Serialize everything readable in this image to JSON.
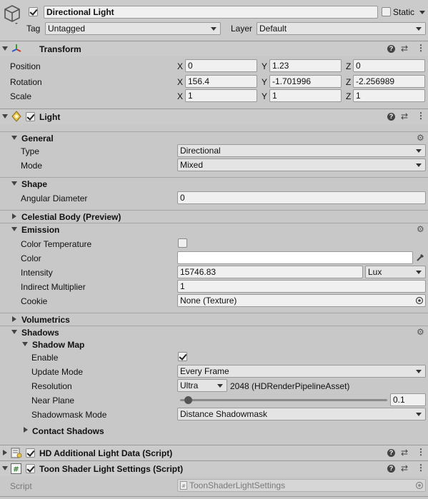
{
  "object": {
    "active": true,
    "name": "Directional Light",
    "static_label": "Static",
    "static_checked": false,
    "tag_label": "Tag",
    "tag_value": "Untagged",
    "layer_label": "Layer",
    "layer_value": "Default"
  },
  "transform": {
    "title": "Transform",
    "position_label": "Position",
    "rotation_label": "Rotation",
    "scale_label": "Scale",
    "axis_x": "X",
    "axis_y": "Y",
    "axis_z": "Z",
    "position": {
      "x": "0",
      "y": "1.23",
      "z": "0"
    },
    "rotation": {
      "x": "156.4",
      "y": "-1.701996",
      "z": "-2.256989"
    },
    "scale": {
      "x": "1",
      "y": "1",
      "z": "1"
    }
  },
  "light": {
    "title": "Light",
    "enabled": true,
    "general": {
      "title": "General",
      "type_label": "Type",
      "type_value": "Directional",
      "mode_label": "Mode",
      "mode_value": "Mixed"
    },
    "shape": {
      "title": "Shape",
      "angular_label": "Angular Diameter",
      "angular_value": "0"
    },
    "celestial": {
      "title": "Celestial Body (Preview)"
    },
    "emission": {
      "title": "Emission",
      "color_temp_label": "Color Temperature",
      "color_label": "Color",
      "color_value": "#ffffff",
      "intensity_label": "Intensity",
      "intensity_value": "15746.83",
      "intensity_unit": "Lux",
      "indirect_label": "Indirect Multiplier",
      "indirect_value": "1",
      "cookie_label": "Cookie",
      "cookie_value": "None (Texture)"
    },
    "volumetrics": {
      "title": "Volumetrics"
    },
    "shadows": {
      "title": "Shadows",
      "shadow_map_title": "Shadow Map",
      "enable_label": "Enable",
      "enable_checked": true,
      "update_label": "Update Mode",
      "update_value": "Every Frame",
      "resolution_label": "Resolution",
      "resolution_value": "Ultra",
      "resolution_detail": "2048 (HDRenderPipelineAsset)",
      "near_plane_label": "Near Plane",
      "near_plane_value": "0.1",
      "near_plane_fraction": 0.02,
      "shadowmask_label": "Shadowmask Mode",
      "shadowmask_value": "Distance Shadowmask",
      "contact_title": "Contact Shadows"
    }
  },
  "hd_additional": {
    "title": "HD Additional Light Data (Script)",
    "enabled": true
  },
  "toon": {
    "title": "Toon Shader Light Settings (Script)",
    "enabled": true,
    "script_label": "Script",
    "script_value": "ToonShaderLightSettings"
  }
}
